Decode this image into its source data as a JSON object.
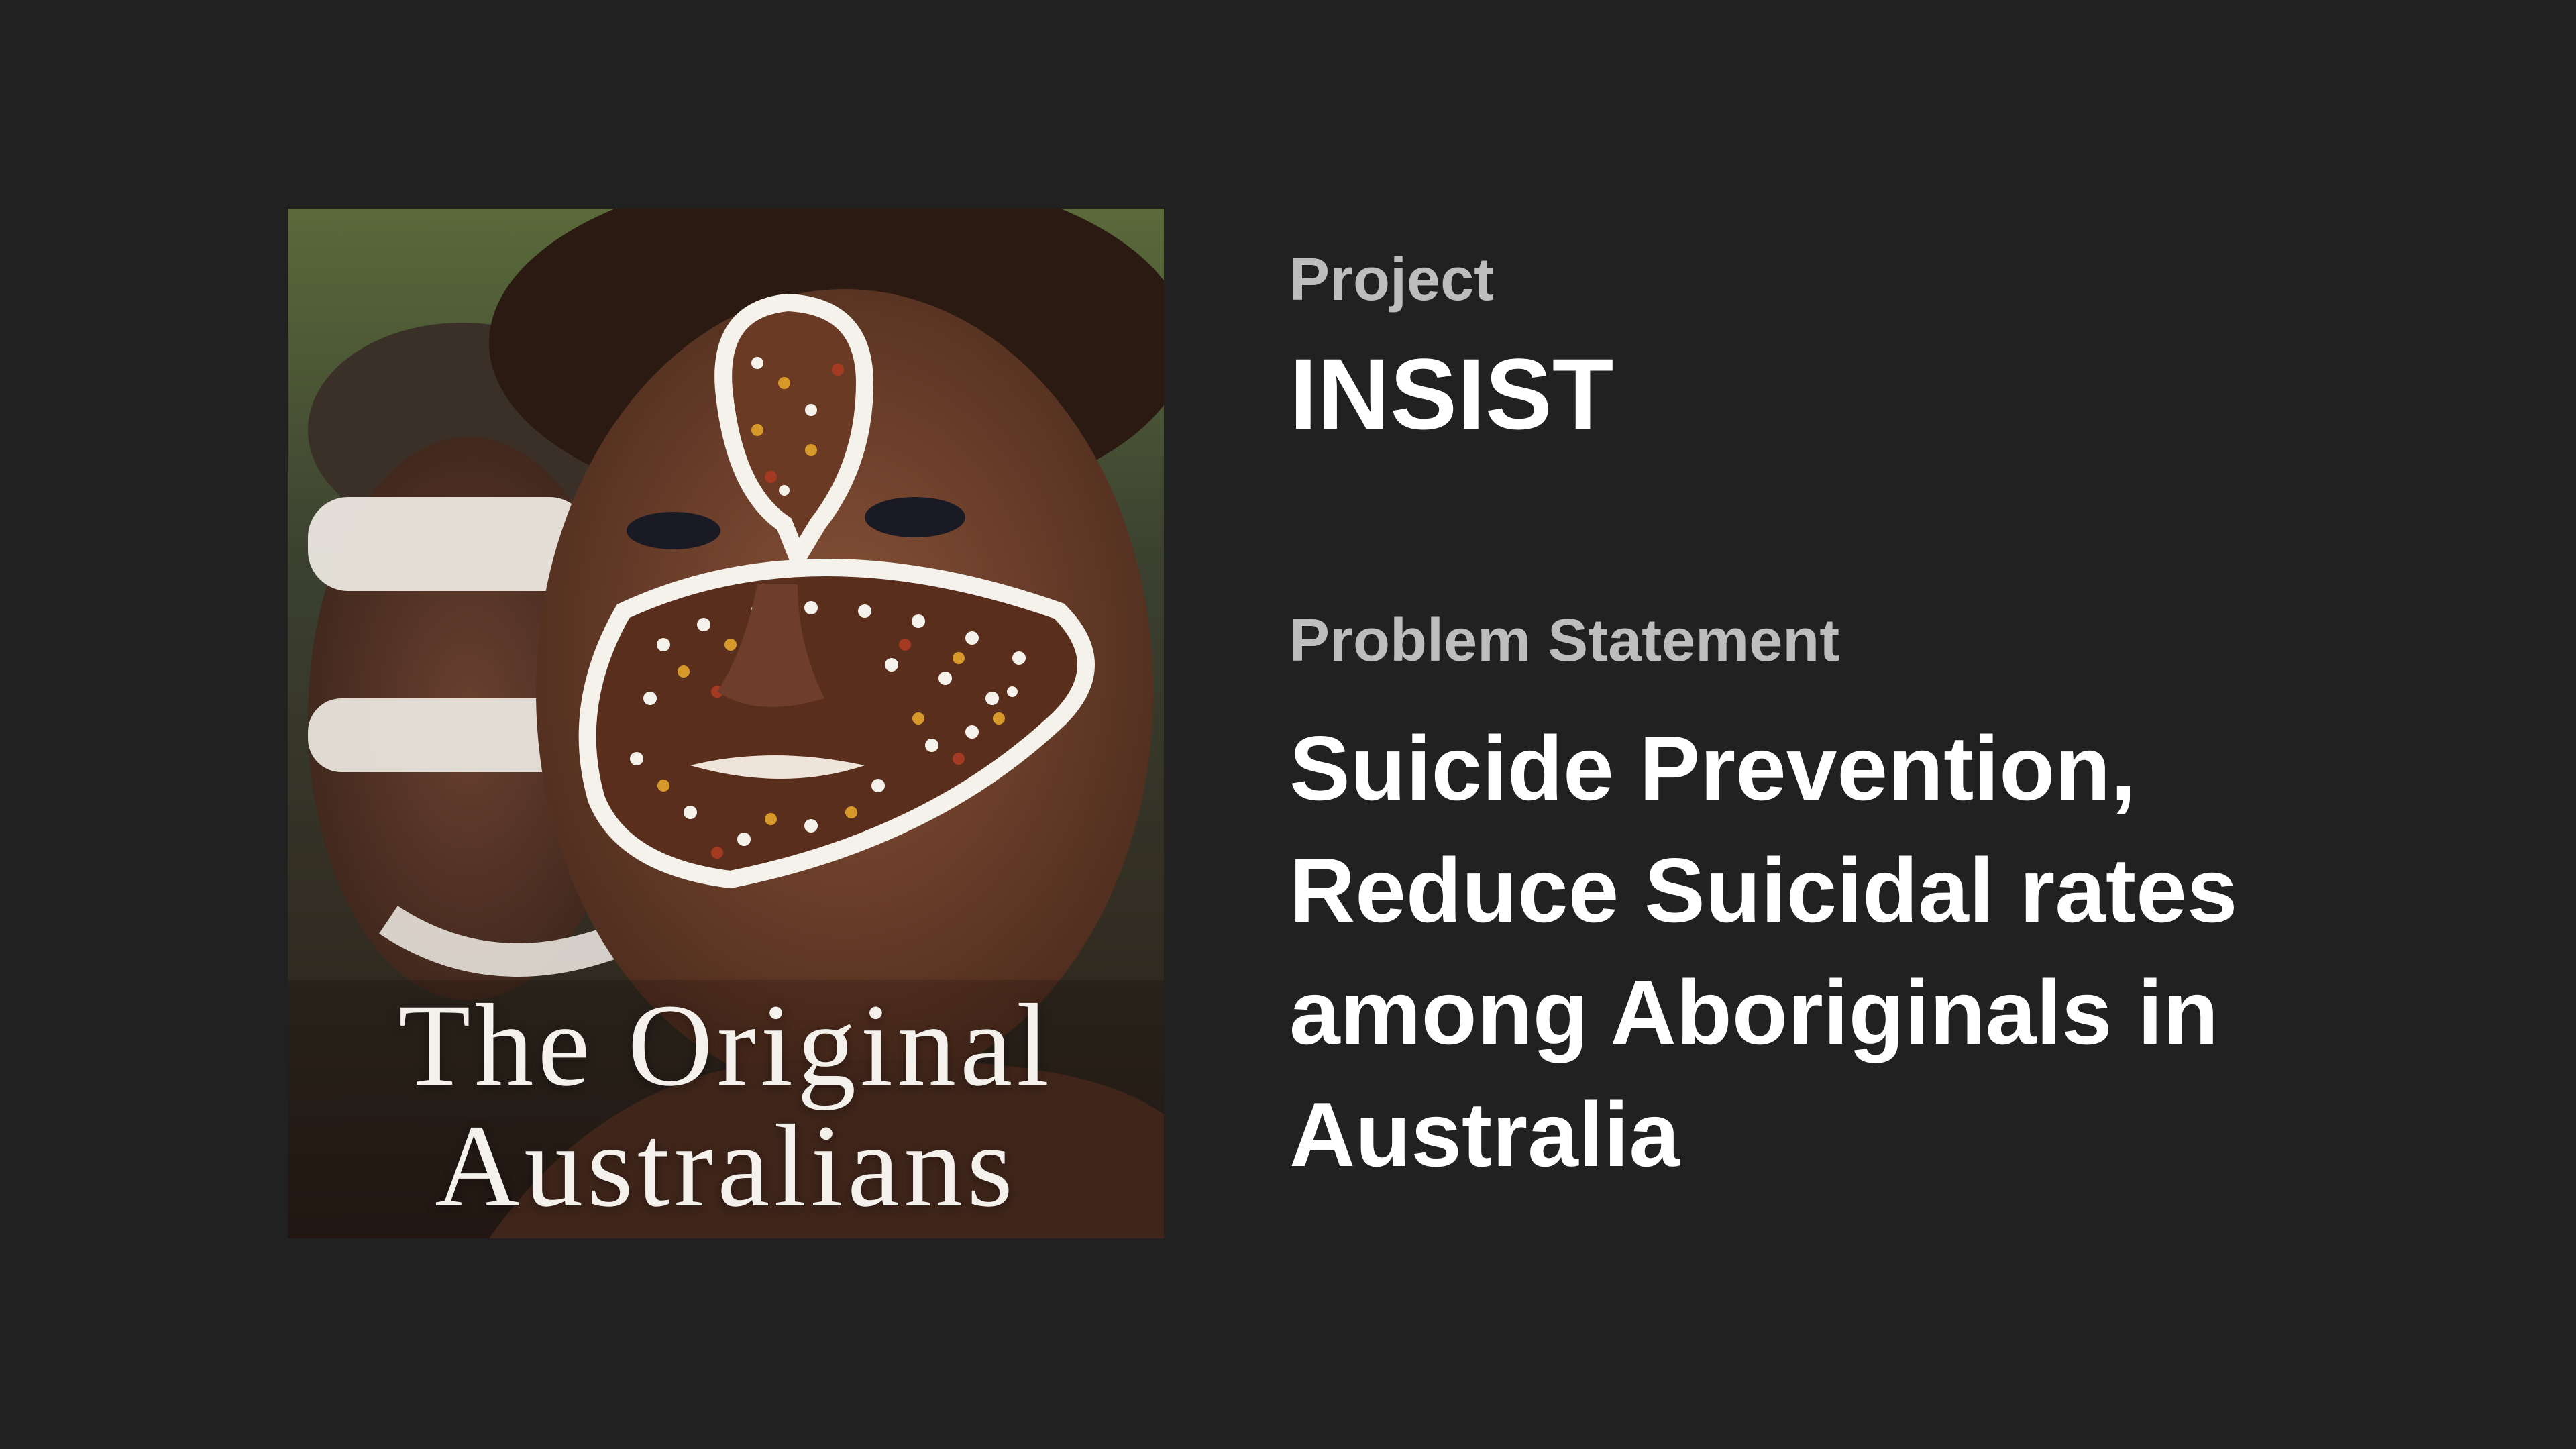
{
  "cover": {
    "title_line1": "The Original",
    "title_line2": "Australians"
  },
  "project": {
    "label": "Project",
    "value": "INSIST"
  },
  "problem": {
    "label": "Problem Statement",
    "lines": [
      "Suicide Prevention,",
      "Reduce Suicidal rates",
      "among Aboriginals in",
      "Australia"
    ]
  },
  "colors": {
    "background": "#212121",
    "label": "#bdbdbd",
    "value": "#ffffff"
  }
}
